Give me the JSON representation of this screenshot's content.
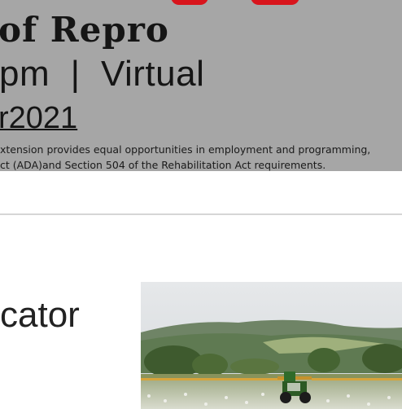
{
  "banner": {
    "title": "of Repro",
    "subtitle": "pm  |  Virtual",
    "date": "r2021",
    "notice_lines": [
      "xtension provides equal opportunities in employment and programming,",
      "ct (ADA)and Section 504 of the Rehabilitation Act requirements."
    ],
    "accent_color": "#d8141c",
    "background_color": "#a6a6a6"
  },
  "article": {
    "heading_fragment": "cator"
  },
  "photo": {
    "subject": "tractor-spraying-field-image"
  }
}
